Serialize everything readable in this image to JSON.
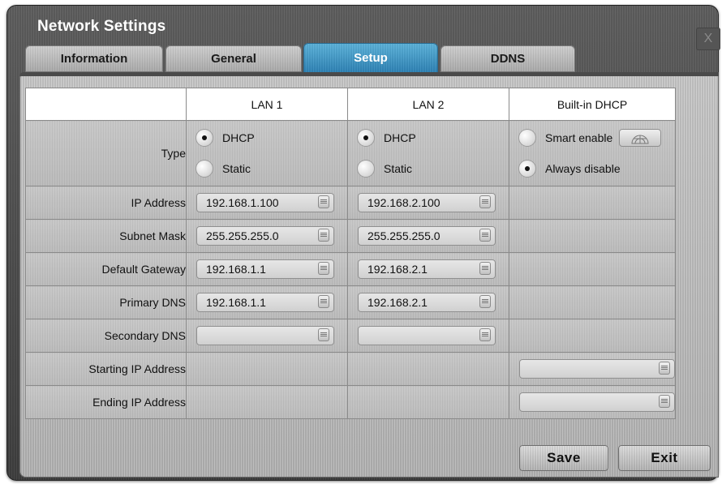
{
  "window": {
    "title": "Network Settings",
    "close_label": "X"
  },
  "tabs": [
    {
      "label": "Information",
      "active": false
    },
    {
      "label": "General",
      "active": false
    },
    {
      "label": "Setup",
      "active": true
    },
    {
      "label": "DDNS",
      "active": false
    }
  ],
  "table": {
    "columns": [
      "LAN 1",
      "LAN 2",
      "Built-in DHCP"
    ],
    "type_label": "Type",
    "lan1_type": {
      "dhcp_label": "DHCP",
      "static_label": "Static",
      "selected": "DHCP"
    },
    "lan2_type": {
      "dhcp_label": "DHCP",
      "static_label": "Static",
      "selected": "DHCP"
    },
    "dhcp_mode": {
      "smart_label": "Smart enable",
      "disable_label": "Always disable",
      "selected": "Always disable"
    },
    "rows": {
      "ip_address": {
        "label": "IP Address",
        "lan1": "192.168.1.100",
        "lan2": "192.168.2.100"
      },
      "subnet_mask": {
        "label": "Subnet Mask",
        "lan1": "255.255.255.0",
        "lan2": "255.255.255.0"
      },
      "default_gateway": {
        "label": "Default Gateway",
        "lan1": "192.168.1.1",
        "lan2": "192.168.2.1"
      },
      "primary_dns": {
        "label": "Primary DNS",
        "lan1": "192.168.1.1",
        "lan2": "192.168.2.1"
      },
      "secondary_dns": {
        "label": "Secondary DNS",
        "lan1": "",
        "lan2": ""
      },
      "starting_ip": {
        "label": "Starting IP Address",
        "dhcp": ""
      },
      "ending_ip": {
        "label": "Ending IP Address",
        "dhcp": ""
      }
    }
  },
  "buttons": {
    "save": "Save",
    "exit": "Exit"
  },
  "icons": {
    "field": "keyboard-icon",
    "smart": "radar-icon"
  },
  "colors": {
    "accent_tab": "#2d82b5",
    "background": "#4a4a4a",
    "panel": "#c2c2c2"
  }
}
